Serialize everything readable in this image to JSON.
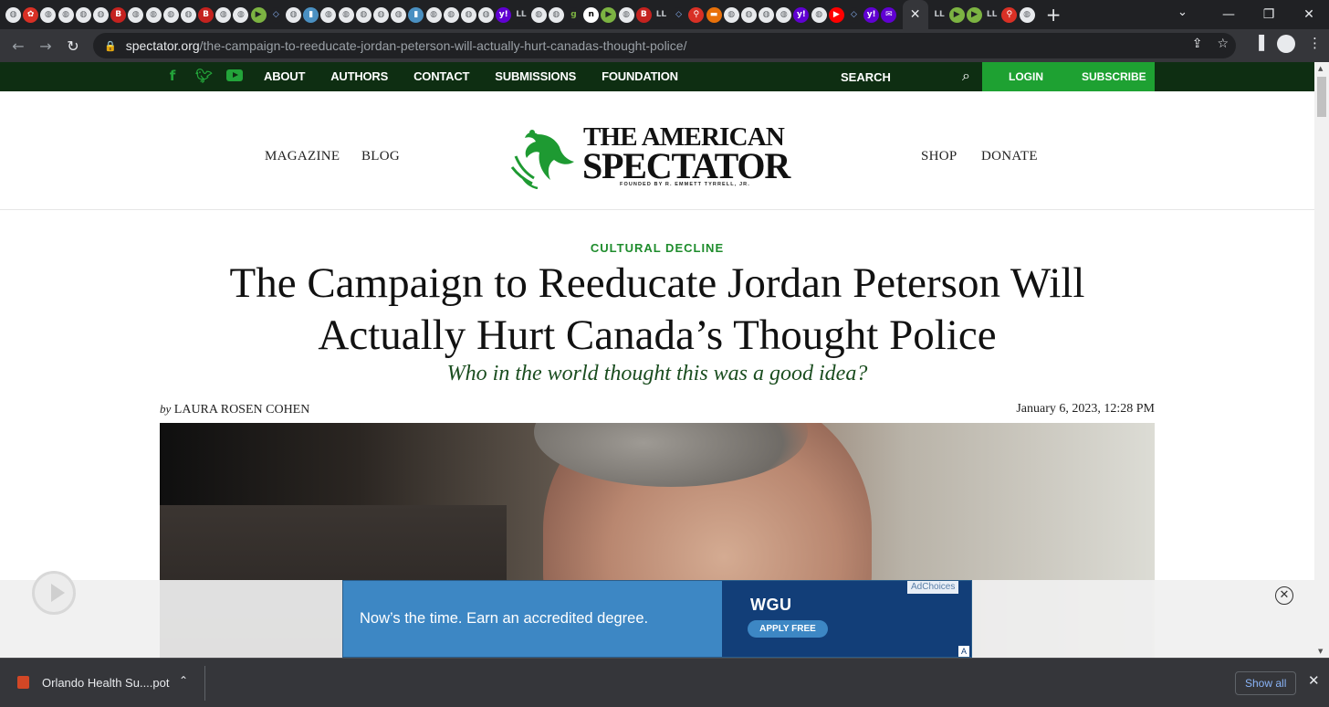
{
  "colors": {
    "tab_bg": "#202124",
    "toolbar_bg": "#35363a",
    "site_nav_bg": "#0e2e12",
    "site_green": "#1ea132",
    "kicker_green": "#1e8c2c",
    "dek_green": "#1a4d1f",
    "ad_blue": "#3d87c4",
    "ad_navy": "#123e78"
  },
  "browser": {
    "tabs": {
      "favicons": [
        "globe-icon",
        "red-flower-icon",
        "globe-icon",
        "globe-icon",
        "globe-icon",
        "globe-icon",
        "b-logo-icon",
        "globe-icon",
        "globe-icon",
        "globe-icon",
        "globe-icon",
        "b-logo-icon",
        "globe-icon",
        "globe-icon",
        "play-icon",
        "shield-icon",
        "globe-icon",
        "video-icon",
        "globe-icon",
        "globe-icon",
        "globe-icon",
        "globe-icon",
        "globe-icon",
        "video-icon",
        "globe-icon",
        "globe-icon",
        "globe-icon",
        "globe-icon",
        "yahoo-icon",
        "ll-icon",
        "globe-icon",
        "globe-icon",
        "g-icon",
        "n-icon",
        "play-icon",
        "globe-icon",
        "b-logo-icon",
        "ll-icon",
        "shield-icon",
        "red-pin-icon",
        "orange-bookmark-icon",
        "globe-icon",
        "globe-icon",
        "globe-icon",
        "globe-icon",
        "yahoo-icon",
        "globe-icon",
        "youtube-icon",
        "shield-icon",
        "yahoo-icon",
        "purple-envelope-icon",
        "close-icon",
        "ll-icon",
        "play-icon",
        "play-icon",
        "ll-icon",
        "red-pin-icon",
        "globe-icon"
      ],
      "active_close": "✕",
      "new_tab": "+"
    },
    "window_controls": {
      "tab_search": "⌄",
      "minimize": "—",
      "maximize": "❐",
      "close": "✕"
    },
    "nav": {
      "back": "←",
      "forward": "→",
      "reload": "↻"
    },
    "url": {
      "host": "spectator.org",
      "path": "/the-campaign-to-reeducate-jordan-peterson-will-actually-hurt-canadas-thought-police/"
    },
    "omnibox_icons": [
      "share-icon",
      "bookmark-star-icon"
    ],
    "toolbar_icons": [
      "side-panel-icon",
      "profile-icon",
      "menu-icon"
    ]
  },
  "site": {
    "social": [
      "f",
      "twitter-icon",
      "youtube-icon"
    ],
    "nav": [
      "ABOUT",
      "AUTHORS",
      "CONTACT",
      "SUBMISSIONS",
      "FOUNDATION"
    ],
    "search_label": "SEARCH",
    "login": "LOGIN",
    "subscribe": "SUBSCRIBE",
    "masthead": {
      "left_links": [
        "MAGAZINE",
        "BLOG"
      ],
      "right_links": [
        "SHOP",
        "DONATE"
      ],
      "logo_line1": "THE AMERICAN",
      "logo_line2": "SPECTATOR",
      "logo_tagline": "FOUNDED BY R. EMMETT TYRRELL, JR."
    }
  },
  "article": {
    "kicker": "CULTURAL DECLINE",
    "headline": "The Campaign to Reeducate Jordan Peterson Will Actually Hurt Canada’s Thought Police",
    "dek": "Who in the world thought this was a good idea?",
    "by": "by",
    "author": "LAURA ROSEN COHEN",
    "date": "January 6, 2023, 12:28 PM"
  },
  "ad": {
    "text": "Now’s the time. Earn an accredited degree.",
    "brand": "WGU",
    "cta": "APPLY FREE",
    "adchoices": "AdChoices"
  },
  "downloads": {
    "file_name": "Orlando Health Su....pot",
    "show_all": "Show all"
  }
}
